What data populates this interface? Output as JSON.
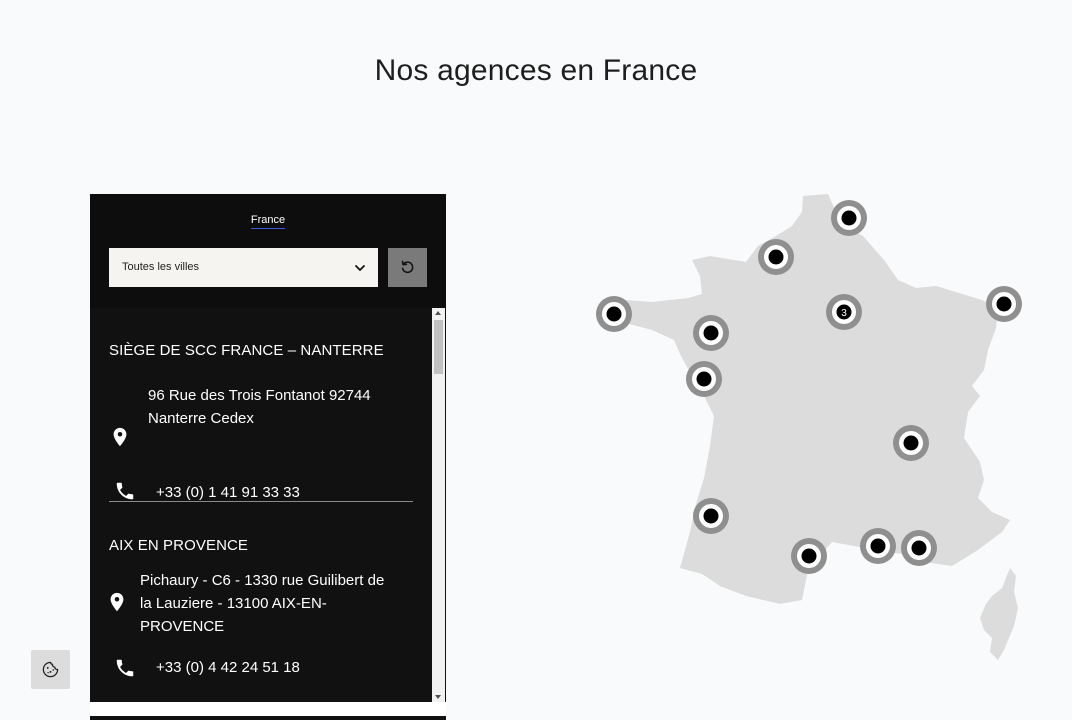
{
  "page": {
    "title": "Nos agences en France"
  },
  "panel": {
    "country_tab": "France",
    "city_select": {
      "selected": "Toutes les villes"
    },
    "reset_icon": "reset-icon"
  },
  "agencies": [
    {
      "name": "SIÈGE DE SCC FRANCE – NANTERRE",
      "address_lines": [
        "96 Rue des Trois Fontanot 92744",
        "Nanterre Cedex"
      ],
      "phone": "+33 (0) 1 41 91 33 33"
    },
    {
      "name": "AIX EN PROVENCE",
      "address_lines": [
        "Pichaury - C6 - 1330 rue Guilibert de",
        "la Lauziere - 13100 AIX-EN-",
        "PROVENCE"
      ],
      "phone": "+33 (0) 4 42 24 51 18"
    }
  ],
  "map": {
    "cluster_count": "3",
    "colors": {
      "land": "#dcdcdc",
      "marker_ring": "#8f8f8f",
      "marker_center": "#000000"
    }
  },
  "icons": {
    "cookie": "cookie-icon",
    "pin": "location-pin-icon",
    "phone": "phone-icon",
    "chevron": "chevron-down-icon"
  }
}
